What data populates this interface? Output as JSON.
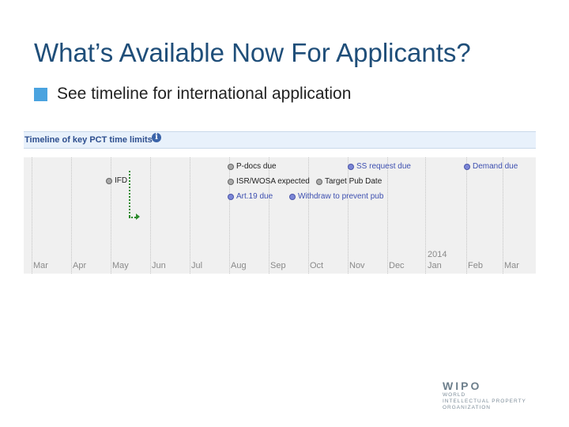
{
  "slide": {
    "title": "What’s Available Now For Applicants?",
    "bullet": "See timeline for international application"
  },
  "timeline": {
    "header": "Timeline of key PCT time limits",
    "info_icon": "info-icon",
    "year_label": "2014",
    "months": [
      "Mar",
      "Apr",
      "May",
      "Jun",
      "Jul",
      "Aug",
      "Sep",
      "Oct",
      "Nov",
      "Dec",
      "Jan",
      "Feb",
      "Mar"
    ],
    "events": [
      {
        "label": "IFD",
        "color": "gray"
      },
      {
        "label": "P-docs due",
        "color": "gray"
      },
      {
        "label": "ISR/WOSA expected",
        "color": "gray"
      },
      {
        "label": "Target Pub Date",
        "color": "gray"
      },
      {
        "label": "Art.19 due",
        "color": "blue"
      },
      {
        "label": "Withdraw to prevent pub",
        "color": "blue"
      },
      {
        "label": "SS request due",
        "color": "blue"
      },
      {
        "label": "Demand due",
        "color": "blue"
      }
    ]
  },
  "logo": {
    "name": "WIPO",
    "line1": "WORLD",
    "line2": "INTELLECTUAL PROPERTY",
    "line3": "ORGANIZATION"
  },
  "colors": {
    "title": "#1f4e79",
    "bullet": "#4aa3df",
    "blue_event": "#3d4fb0",
    "gray_event_dot": "#a9a9a9",
    "ifd_line": "#2e8b2e"
  }
}
